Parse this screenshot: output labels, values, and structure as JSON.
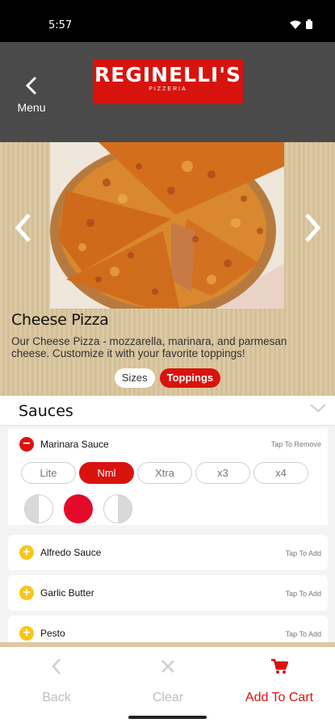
{
  "status_bar": {
    "time": "5:57"
  },
  "header": {
    "back_label": "Menu",
    "logo_main": "REGINELLI'S",
    "logo_sub": "PIZZERIA"
  },
  "product": {
    "name": "Cheese Pizza",
    "description": "Our Cheese Pizza - mozzarella, marinara, and parmesan cheese.  Customize it with your favorite toppings!",
    "tabs": [
      {
        "label": "Sizes",
        "active": false
      },
      {
        "label": "Toppings",
        "active": true
      }
    ]
  },
  "sauces": {
    "title": "Sauces",
    "selected": {
      "label": "Marinara Sauce",
      "action": "Tap To Remove",
      "amounts": [
        "Lite",
        "Nml",
        "Xtra",
        "x3",
        "x4"
      ],
      "selected_amount": "Nml",
      "portion_selected": "whole"
    },
    "items": [
      {
        "label": "Alfredo Sauce",
        "action": "Tap To Add"
      },
      {
        "label": "Garlic Butter",
        "action": "Tap To Add"
      },
      {
        "label": "Pesto",
        "action": "Tap To Add"
      }
    ]
  },
  "bottom_bar": {
    "back": "Back",
    "clear": "Clear",
    "add_to_cart": "Add To Cart"
  },
  "colors": {
    "brand_red": "#d8130e",
    "add_yellow": "#f8c51b",
    "header_gray": "#4a4a4a",
    "hero_tan": "#dcc9a3"
  }
}
